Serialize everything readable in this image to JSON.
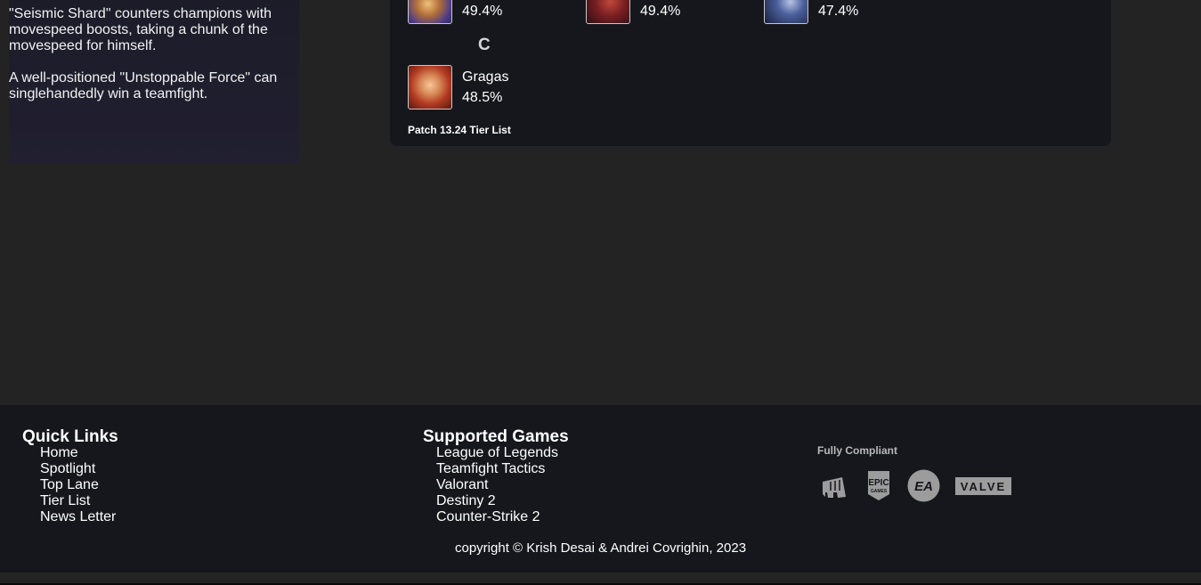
{
  "tips": {
    "paragraph1": "\"Seismic Shard\" counters champions with movespeed boosts, taking a chunk of the movespeed for himself.",
    "paragraph2": "A well-positioned \"Unstoppable Force\" can singlehandedly win a teamfight."
  },
  "tier_list": {
    "top_row": [
      {
        "winrate": "49.4%",
        "icon": "champion-portrait-gold-armor"
      },
      {
        "winrate": "49.4%",
        "icon": "champion-portrait-red-demon"
      },
      {
        "winrate": "47.4%",
        "icon": "champion-portrait-blue-swordsman"
      }
    ],
    "tier_c": {
      "letter": "C",
      "champions": [
        {
          "name": "Gragas",
          "winrate": "48.5%",
          "icon": "gragas-portrait"
        }
      ]
    },
    "patch_label": "Patch 13.24 Tier List"
  },
  "footer": {
    "quick_links": {
      "title": "Quick Links",
      "items": [
        "Home",
        "Spotlight",
        "Top Lane",
        "Tier List",
        "News Letter"
      ]
    },
    "supported_games": {
      "title": "Supported Games",
      "items": [
        "League of Legends",
        "Teamfight Tactics",
        "Valorant",
        "Destiny 2",
        "Counter-Strike 2"
      ]
    },
    "compliance": {
      "label": "Fully Compliant",
      "logos": [
        "riot-games-logo",
        "epic-games-logo",
        "ea-logo",
        "valve-logo"
      ],
      "epic_text_top": "EPIC",
      "epic_text_bottom": "GAMES",
      "ea_text": "EA",
      "valve_text": "VALVE"
    },
    "copyright": "copyright © Krish Desai & Andrei Covrighin, 2023"
  },
  "colors": {
    "page_bg": "#232323",
    "card_bg": "#16171d",
    "footer_bg": "#16171d",
    "logo_gray": "#9c9c9c"
  }
}
